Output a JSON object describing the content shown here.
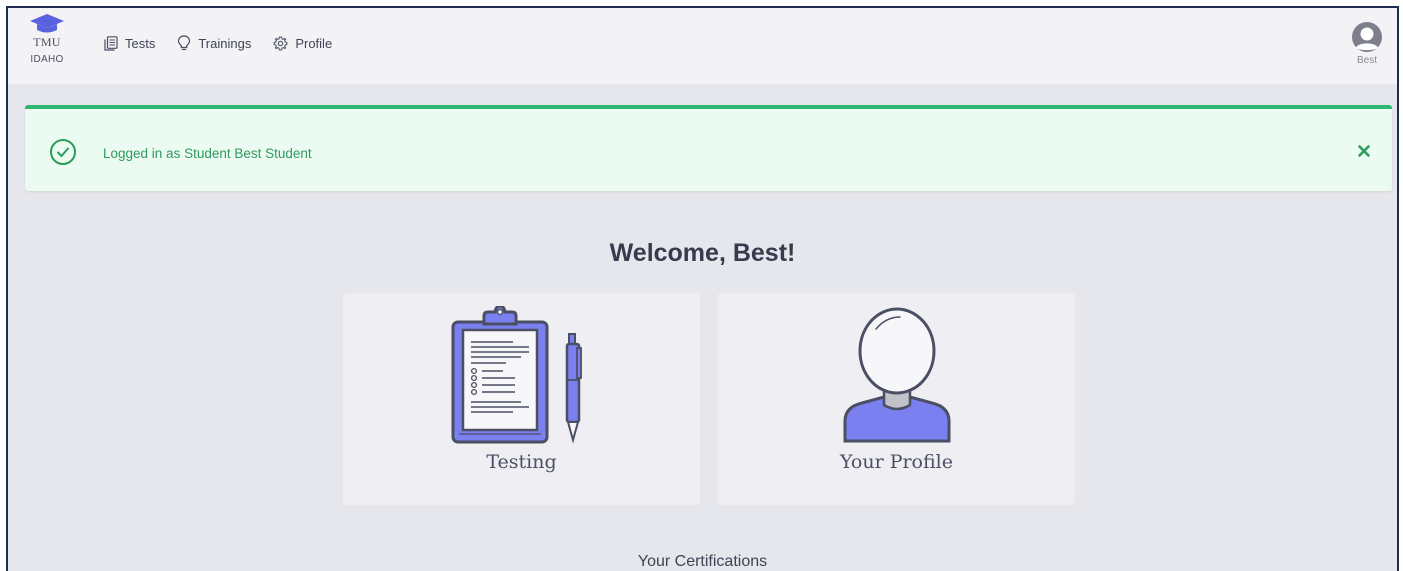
{
  "logo": {
    "line1": "TMU",
    "line2": "IDAHO",
    "icon": "graduation-cap-icon",
    "color": "#5b62e0"
  },
  "nav": {
    "items": [
      {
        "label": "Tests",
        "icon": "document-list-icon"
      },
      {
        "label": "Trainings",
        "icon": "lightbulb-icon"
      },
      {
        "label": "Profile",
        "icon": "gear-icon"
      }
    ]
  },
  "user": {
    "name": "Best",
    "icon": "user-avatar-icon"
  },
  "alert": {
    "message": "Logged in as Student Best Student",
    "icon": "check-circle-icon",
    "close_icon": "close-icon",
    "color": "#2fb872"
  },
  "main": {
    "welcome": "Welcome, Best!",
    "cards": [
      {
        "label": "Testing",
        "icon": "clipboard-icon"
      },
      {
        "label": "Your Profile",
        "icon": "person-icon"
      }
    ],
    "certifications_heading": "Your Certifications"
  },
  "colors": {
    "accent": "#7b80f0",
    "success": "#2fb872",
    "background": "#e6e7ec"
  }
}
